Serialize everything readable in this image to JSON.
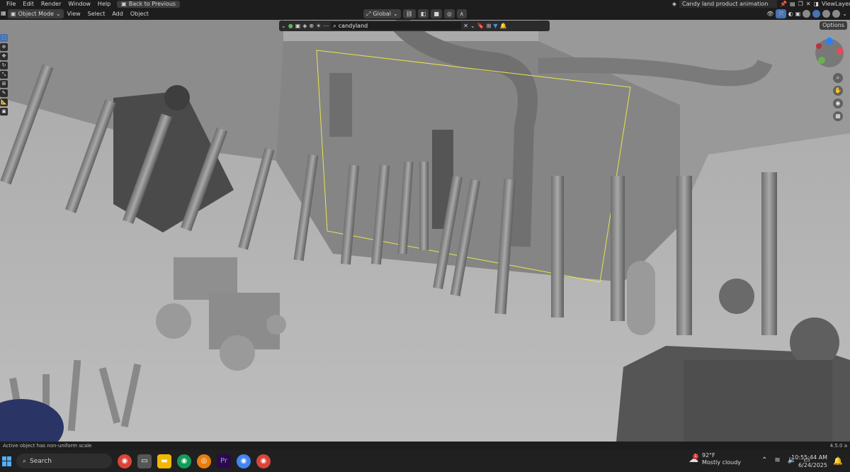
{
  "topbar": {
    "menus": [
      "File",
      "Edit",
      "Render",
      "Window",
      "Help"
    ],
    "back_label": "Back to Previous",
    "scene_name": "Candy land product animation",
    "view_layer": "ViewLayer"
  },
  "viewport_header": {
    "mode": "Object Mode",
    "menus": [
      "View",
      "Select",
      "Add",
      "Object"
    ],
    "transform_orientation": "Global",
    "options_label": "Options"
  },
  "outliner_filter": {
    "search_value": "candyland"
  },
  "toolbar": {
    "tools": [
      "select-box-icon",
      "cursor-icon",
      "move-icon",
      "rotate-icon",
      "scale-icon",
      "transform-icon",
      "annotate-icon",
      "measure-icon",
      "add-cube-icon"
    ]
  },
  "status": {
    "message": "Active object has non-uniform scale",
    "version": "4.5.0 a"
  },
  "taskbar": {
    "search_label": "Search",
    "weather_temp": "92°F",
    "weather_desc": "Mostly cloudy",
    "weather_badge": "1",
    "time": "10:55:44 AM",
    "date": "6/24/2025",
    "apps": [
      {
        "name": "chrome-icon",
        "color": "#db4437"
      },
      {
        "name": "task-view-icon",
        "color": "#888888"
      },
      {
        "name": "file-explorer-icon",
        "color": "#f2b700"
      },
      {
        "name": "chrome-icon",
        "color": "#0f9d58"
      },
      {
        "name": "blender-icon",
        "color": "#e87d0d"
      },
      {
        "name": "premiere-icon",
        "color": "#2a0a4a"
      },
      {
        "name": "chrome-icon",
        "color": "#4285f4"
      },
      {
        "name": "chrome-icon",
        "color": "#db4437"
      }
    ]
  },
  "colors": {
    "accent": "#4772b3",
    "camera_frame": "#e8e64a",
    "viewport_bg": "#9e9e9e"
  }
}
